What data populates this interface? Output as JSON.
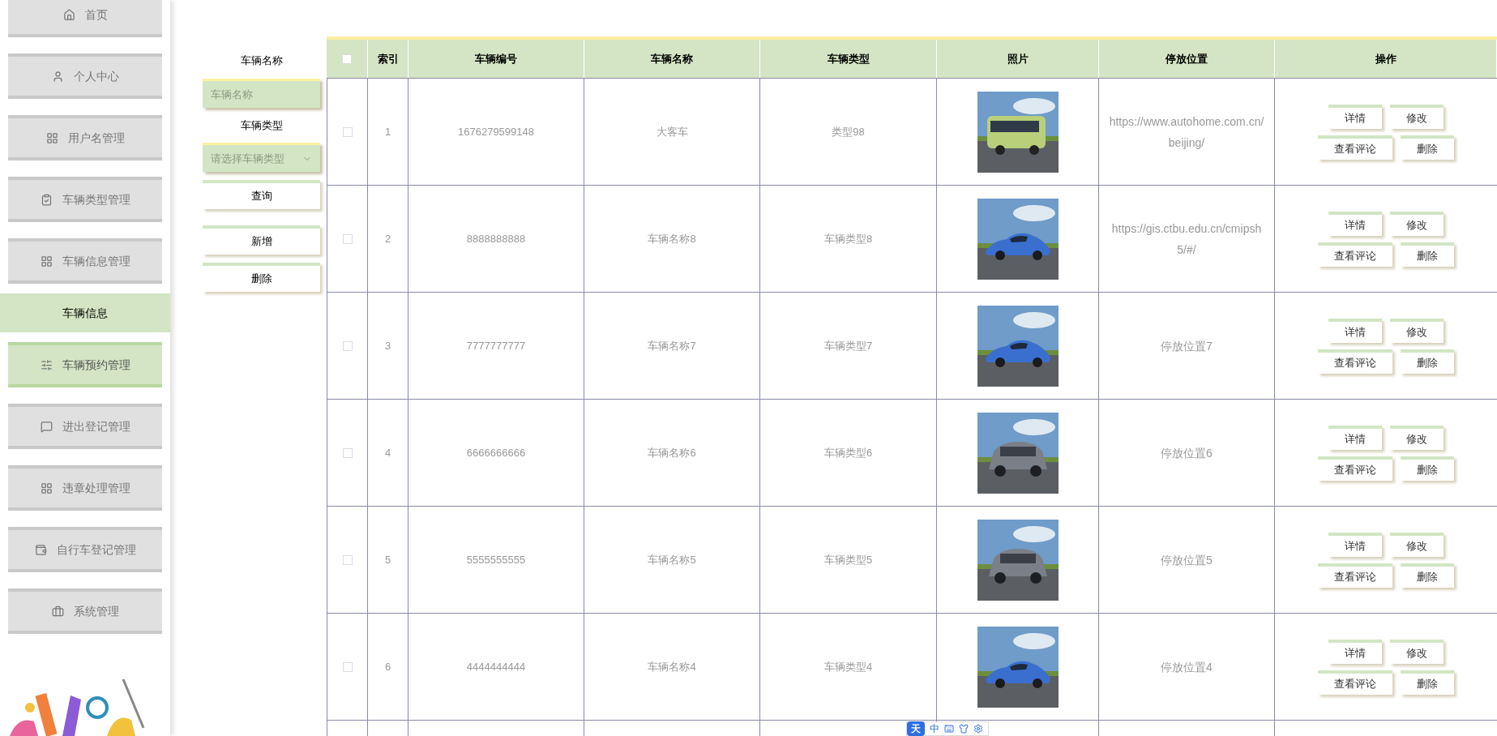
{
  "sidebar": {
    "items": [
      {
        "label": "首页",
        "hovered": false
      },
      {
        "label": "个人中心",
        "hovered": false
      },
      {
        "label": "用户名管理",
        "hovered": false
      },
      {
        "label": "车辆类型管理",
        "hovered": false
      },
      {
        "label": "车辆信息管理",
        "hovered": false,
        "expanded": true,
        "children": [
          {
            "label": "车辆信息",
            "selected": true
          }
        ]
      },
      {
        "label": "车辆预约管理",
        "hovered": true
      },
      {
        "label": "进出登记管理",
        "hovered": false
      },
      {
        "label": "违章处理管理",
        "hovered": false
      },
      {
        "label": "自行车登记管理",
        "hovered": false
      },
      {
        "label": "系统管理",
        "hovered": false
      }
    ]
  },
  "search": {
    "fields": [
      {
        "kind": "input",
        "label": "车辆名称",
        "placeholder": "车辆名称"
      },
      {
        "kind": "select",
        "label": "车辆类型",
        "placeholder": "请选择车辆类型"
      }
    ],
    "buttons": [
      "查询",
      "新增",
      "删除"
    ]
  },
  "table": {
    "columns": [
      "索引",
      "车辆编号",
      "车辆名称",
      "车辆类型",
      "照片",
      "停放位置",
      "操作"
    ],
    "header_checked": false,
    "rows": [
      {
        "checked": false,
        "index": "1",
        "number": "1676279599148",
        "name": "大客车",
        "type": "类型98",
        "location": "https://www.autohome.com.cn/beijing/",
        "actions": [
          "详情",
          "修改",
          "查看评论",
          "删除"
        ]
      },
      {
        "checked": false,
        "index": "2",
        "number": "8888888888",
        "name": "车辆名称8",
        "type": "车辆类型8",
        "location": "https://gis.ctbu.edu.cn/cmipsh5/#/",
        "actions": [
          "详情",
          "修改",
          "查看评论",
          "删除"
        ]
      },
      {
        "checked": false,
        "index": "3",
        "number": "7777777777",
        "name": "车辆名称7",
        "type": "车辆类型7",
        "location": "停放位置7",
        "actions": [
          "详情",
          "修改",
          "查看评论",
          "删除"
        ]
      },
      {
        "checked": false,
        "index": "4",
        "number": "6666666666",
        "name": "车辆名称6",
        "type": "车辆类型6",
        "location": "停放位置6",
        "actions": [
          "详情",
          "修改",
          "查看评论",
          "删除"
        ]
      },
      {
        "checked": false,
        "index": "5",
        "number": "5555555555",
        "name": "车辆名称5",
        "type": "车辆类型5",
        "location": "停放位置5",
        "actions": [
          "详情",
          "修改",
          "查看评论",
          "删除"
        ]
      },
      {
        "checked": false,
        "index": "6",
        "number": "4444444444",
        "name": "车辆名称4",
        "type": "车辆类型4",
        "location": "停放位置4",
        "actions": [
          "详情",
          "修改",
          "查看评论",
          "删除"
        ]
      }
    ]
  },
  "ime_toolbar": {
    "logo": "天",
    "mode": "中"
  }
}
